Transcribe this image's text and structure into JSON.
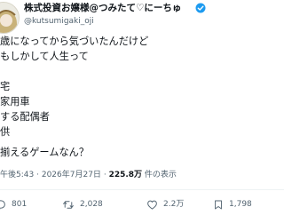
{
  "author": {
    "name": "株式投資お嬢様@つみたて♡にーちゅ",
    "handle": "@kutsumigaki_oji"
  },
  "body_lines": [
    "歳になってから気づいたんだけど",
    "もしかして人生って",
    "",
    "宅",
    "家用車",
    "する配偶者",
    "供",
    "",
    "揃えるゲームなん？"
  ],
  "meta": {
    "time": "午後5:43",
    "date": "2026年7月27日",
    "separator": "·",
    "views_count": "225.8万",
    "views_label": "件の表示"
  },
  "actions": {
    "reply_count": "801",
    "repost_count": "2,028",
    "like_count": "2.2万",
    "bookmark_count": "1,798"
  },
  "colors": {
    "text": "#0f1419",
    "secondary": "#536471",
    "divider": "#eff3f4",
    "verified": "#1d9bf0"
  }
}
